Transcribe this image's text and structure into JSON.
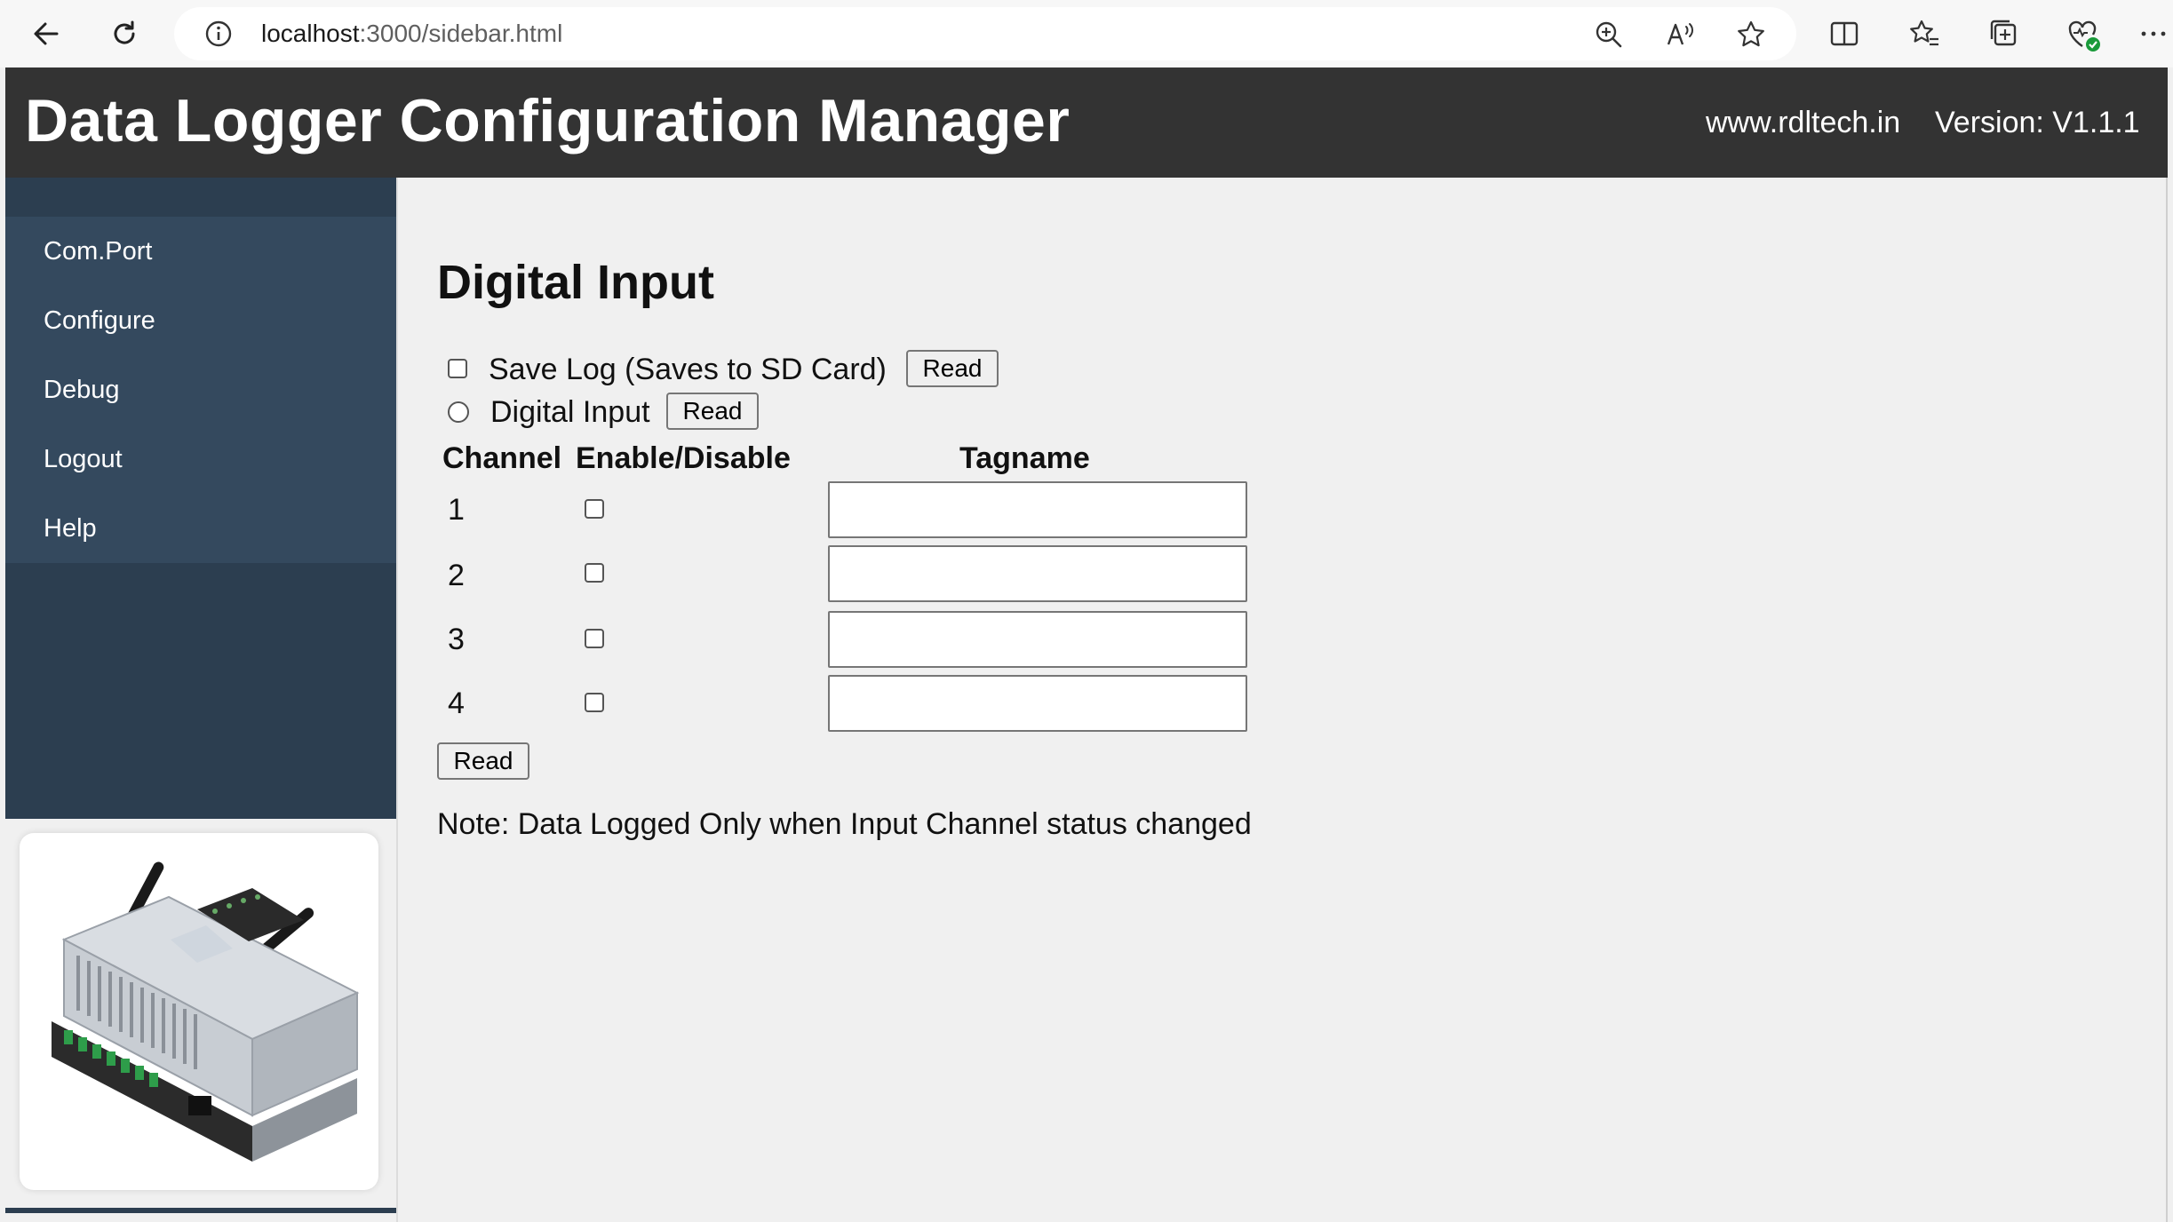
{
  "browser": {
    "url_host": "localhost",
    "url_path": ":3000/sidebar.html"
  },
  "header": {
    "title": "Data Logger Configuration Manager",
    "website": "www.rdltech.in",
    "version": "Version: V1.1.1"
  },
  "sidebar": {
    "items": [
      {
        "label": "Com.Port"
      },
      {
        "label": "Configure"
      },
      {
        "label": "Debug"
      },
      {
        "label": "Logout"
      },
      {
        "label": "Help"
      }
    ]
  },
  "main": {
    "heading": "Digital Input",
    "save_log_label": "Save Log (Saves to SD Card)",
    "save_log_checked": false,
    "save_log_read": "Read",
    "digital_input_label": "Digital Input",
    "digital_input_selected": false,
    "digital_input_read": "Read",
    "columns": {
      "channel": "Channel",
      "enable": "Enable/Disable",
      "tagname": "Tagname"
    },
    "channels": [
      {
        "number": "1",
        "enabled": false,
        "tagname": ""
      },
      {
        "number": "2",
        "enabled": false,
        "tagname": ""
      },
      {
        "number": "3",
        "enabled": false,
        "tagname": ""
      },
      {
        "number": "4",
        "enabled": false,
        "tagname": ""
      }
    ],
    "read_button": "Read",
    "note": "Note: Data Logged Only when Input Channel status changed"
  },
  "colors": {
    "header_bg": "#333333",
    "sidebar_bg": "#2c3e50",
    "menu_item_bg": "#34495e",
    "page_bg": "#f0f0f0"
  },
  "icons": [
    "back-arrow-icon",
    "refresh-icon",
    "info-icon",
    "zoom-icon",
    "read-aloud-icon",
    "favorite-star-icon",
    "split-screen-icon",
    "favorites-icon",
    "collections-icon",
    "browser-essentials-icon",
    "more-menu-icon"
  ]
}
